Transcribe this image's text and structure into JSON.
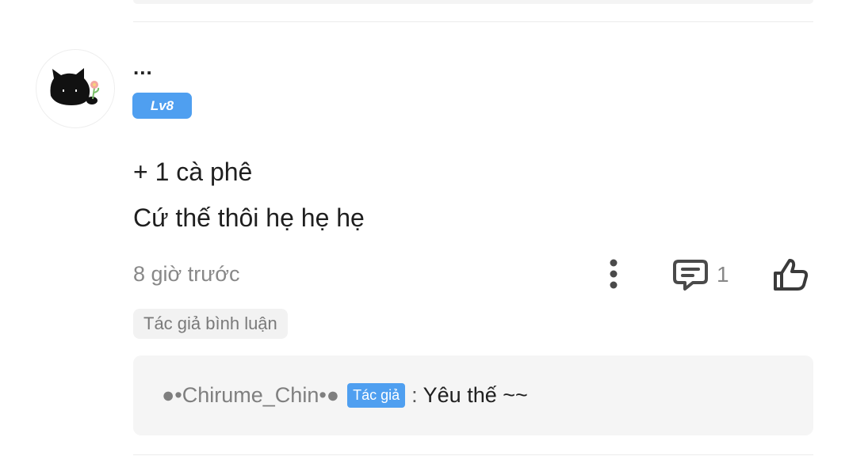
{
  "comment": {
    "user": {
      "name": "...",
      "level": "Lv8",
      "avatar_icon": "black-cat-avatar"
    },
    "lines": [
      "+ 1 cà phê",
      "Cứ thế thôi hẹ hẹ hẹ"
    ],
    "time": "8 giờ trước",
    "actions": {
      "more_icon": "more-vertical-icon",
      "reply_icon": "comment-icon",
      "reply_count": "1",
      "like_icon": "thumbs-up-icon"
    },
    "author_tag": "Tác giả bình luận"
  },
  "reply": {
    "author": "●•Chirume_Chin•●",
    "author_badge": "Tác giả",
    "separator": ":",
    "text": "Yêu thế ~~"
  },
  "colors": {
    "accent": "#4f9ff0",
    "muted_text": "#888888",
    "tag_bg": "#f2f2f2",
    "reply_bg": "#f5f5f5"
  }
}
